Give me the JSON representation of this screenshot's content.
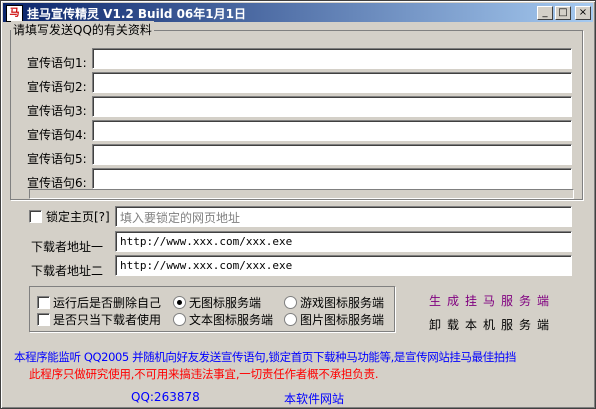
{
  "window": {
    "app_icon_glyph": "马",
    "title": "挂马宣传精灵 V1.2  Build 06年1月1日",
    "minimize_glyph": "_",
    "maximize_glyph": "□",
    "close_glyph": "×"
  },
  "group": {
    "title": "请填写发送QQ的有关资料",
    "slogans": [
      {
        "label": "宣传语句1:",
        "value": ""
      },
      {
        "label": "宣传语句2:",
        "value": ""
      },
      {
        "label": "宣传语句3:",
        "value": ""
      },
      {
        "label": "宣传语句4:",
        "value": ""
      },
      {
        "label": "宣传语句5:",
        "value": ""
      },
      {
        "label": "宣传语句6:",
        "value": ""
      }
    ]
  },
  "homepage": {
    "lock_label": "锁定主页[?]",
    "lock_checked": false,
    "placeholder": "填入要锁定的网页地址"
  },
  "downloader": {
    "url1_label": "下载者地址一",
    "url1_value": "http://www.xxx.com/xxx.exe",
    "url2_label": "下载者地址二",
    "url2_value": "http://www.xxx.com/xxx.exe"
  },
  "options": {
    "delete_self_label": "运行后是否删除自己",
    "only_downloader_label": "是否只当下载者使用",
    "icon_radios": [
      {
        "label": "无图标服务端",
        "selected": true
      },
      {
        "label": "游戏图标服务端",
        "selected": false
      },
      {
        "label": "文本图标服务端",
        "selected": false
      },
      {
        "label": "图片图标服务端",
        "selected": false
      }
    ]
  },
  "actions": {
    "generate": "生成挂马服务端",
    "uninstall": "卸载本机服务端"
  },
  "info": {
    "line1": "本程序能监听 QQ2005 并随机向好友发送宣传语句,锁定首页下载种马功能等,是宣传网站挂马最佳拍挡",
    "line2": "此程序只做研究使用,不可用来搞违法事宜,一切责任作者概不承担负责."
  },
  "footer": {
    "qq": "QQ:263878",
    "site": "本软件网站"
  },
  "colors": {
    "face": "#d4d0c8",
    "title_start": "#0a246a",
    "title_end": "#a6caf0",
    "generate": "#800080",
    "info_blue": "#0000ff",
    "info_red": "#ff0000"
  }
}
